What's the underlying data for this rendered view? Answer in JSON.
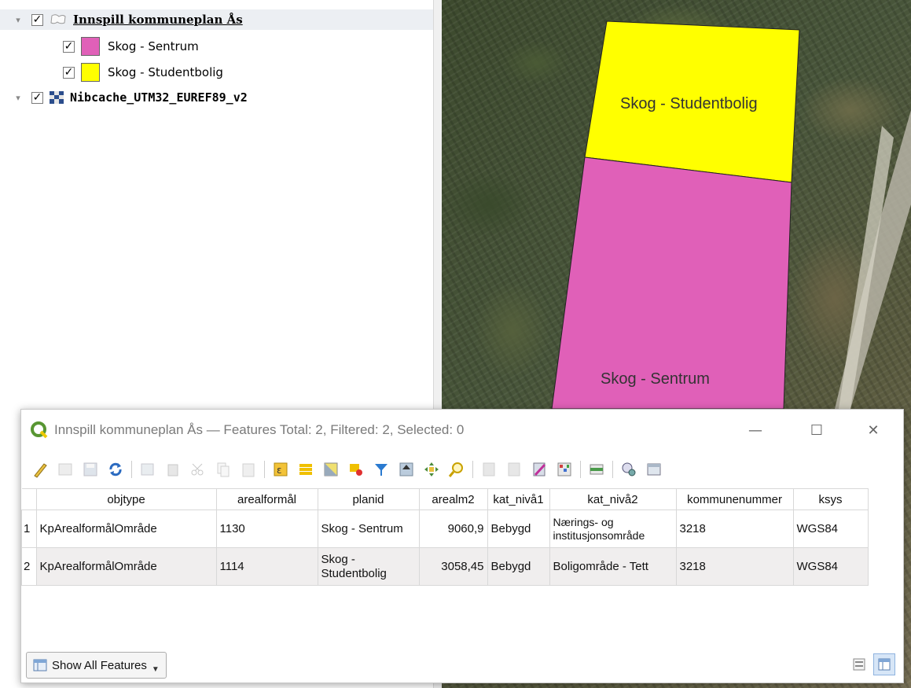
{
  "layers": {
    "group": {
      "name": "Innspill kommuneplan Ås",
      "checked": true,
      "expanded": true
    },
    "items": [
      {
        "label": "Skog - Sentrum",
        "color": "#E060B8",
        "checked": true
      },
      {
        "label": "Skog - Studentbolig",
        "color": "#FFFF00",
        "checked": true
      }
    ],
    "raster": {
      "name": "Nibcache_UTM32_EUREF89_v2",
      "checked": true
    },
    "check_glyph": "✓",
    "expand_glyph": "▾"
  },
  "map": {
    "labels": {
      "studentbolig": "Skog - Studentbolig",
      "sentrum": "Skog - Sentrum"
    },
    "colors": {
      "sentrum": "#E060B8",
      "studentbolig": "#FFFF00"
    }
  },
  "attribute_window": {
    "title": "Innspill kommuneplan Ås — Features Total: 2, Filtered: 2, Selected: 0",
    "controls": {
      "minimize": "—",
      "maximize": "☐",
      "close": "✕"
    },
    "toolbar_icons": [
      "toggle-editing-icon",
      "multi-edit-icon",
      "save-edits-icon",
      "reload-icon",
      "add-feature-icon",
      "delete-feature-icon",
      "cut-icon",
      "copy-icon",
      "paste-icon",
      "select-by-expression-icon",
      "select-all-icon",
      "invert-selection-icon",
      "deselect-icon",
      "filter-icon",
      "move-selection-top-icon",
      "pan-to-selection-icon",
      "zoom-to-selection-icon",
      "new-field-icon",
      "delete-field-icon",
      "field-calculator-icon",
      "conditional-formatting-icon",
      "dock-icon",
      "actions-icon",
      "table-view-options-icon"
    ],
    "columns": [
      "objtype",
      "arealformål",
      "planid",
      "arealm2",
      "kat_nivå1",
      "kat_nivå2",
      "kommunenummer",
      "ksys"
    ],
    "rows": [
      {
        "n": "1",
        "cells": [
          "KpArealformålOmråde",
          "1130",
          "Skog - Sentrum",
          "9060,9",
          "Bebygd",
          "Nærings- og institusjonsområde",
          "3218",
          "WGS84"
        ]
      },
      {
        "n": "2",
        "cells": [
          "KpArealformålOmråde",
          "1114",
          "Skog - Studentbolig",
          "3058,45",
          "Bebygd",
          "Boligområde - Tett",
          "3218",
          "WGS84"
        ]
      }
    ],
    "footer": {
      "show_button": "Show All Features"
    }
  }
}
